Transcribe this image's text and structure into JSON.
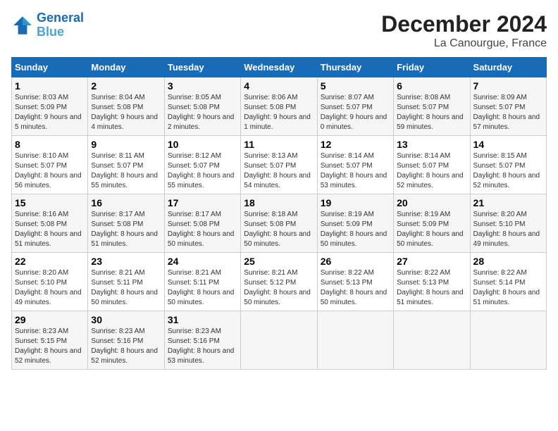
{
  "header": {
    "logo_line1": "General",
    "logo_line2": "Blue",
    "title": "December 2024",
    "subtitle": "La Canourgue, France"
  },
  "weekdays": [
    "Sunday",
    "Monday",
    "Tuesday",
    "Wednesday",
    "Thursday",
    "Friday",
    "Saturday"
  ],
  "weeks": [
    [
      {
        "day": 1,
        "sunrise": "8:03 AM",
        "sunset": "5:09 PM",
        "daylight": "9 hours and 5 minutes."
      },
      {
        "day": 2,
        "sunrise": "8:04 AM",
        "sunset": "5:08 PM",
        "daylight": "9 hours and 4 minutes."
      },
      {
        "day": 3,
        "sunrise": "8:05 AM",
        "sunset": "5:08 PM",
        "daylight": "9 hours and 2 minutes."
      },
      {
        "day": 4,
        "sunrise": "8:06 AM",
        "sunset": "5:08 PM",
        "daylight": "9 hours and 1 minute."
      },
      {
        "day": 5,
        "sunrise": "8:07 AM",
        "sunset": "5:07 PM",
        "daylight": "9 hours and 0 minutes."
      },
      {
        "day": 6,
        "sunrise": "8:08 AM",
        "sunset": "5:07 PM",
        "daylight": "8 hours and 59 minutes."
      },
      {
        "day": 7,
        "sunrise": "8:09 AM",
        "sunset": "5:07 PM",
        "daylight": "8 hours and 57 minutes."
      }
    ],
    [
      {
        "day": 8,
        "sunrise": "8:10 AM",
        "sunset": "5:07 PM",
        "daylight": "8 hours and 56 minutes."
      },
      {
        "day": 9,
        "sunrise": "8:11 AM",
        "sunset": "5:07 PM",
        "daylight": "8 hours and 55 minutes."
      },
      {
        "day": 10,
        "sunrise": "8:12 AM",
        "sunset": "5:07 PM",
        "daylight": "8 hours and 55 minutes."
      },
      {
        "day": 11,
        "sunrise": "8:13 AM",
        "sunset": "5:07 PM",
        "daylight": "8 hours and 54 minutes."
      },
      {
        "day": 12,
        "sunrise": "8:14 AM",
        "sunset": "5:07 PM",
        "daylight": "8 hours and 53 minutes."
      },
      {
        "day": 13,
        "sunrise": "8:14 AM",
        "sunset": "5:07 PM",
        "daylight": "8 hours and 52 minutes."
      },
      {
        "day": 14,
        "sunrise": "8:15 AM",
        "sunset": "5:07 PM",
        "daylight": "8 hours and 52 minutes."
      }
    ],
    [
      {
        "day": 15,
        "sunrise": "8:16 AM",
        "sunset": "5:08 PM",
        "daylight": "8 hours and 51 minutes."
      },
      {
        "day": 16,
        "sunrise": "8:17 AM",
        "sunset": "5:08 PM",
        "daylight": "8 hours and 51 minutes."
      },
      {
        "day": 17,
        "sunrise": "8:17 AM",
        "sunset": "5:08 PM",
        "daylight": "8 hours and 50 minutes."
      },
      {
        "day": 18,
        "sunrise": "8:18 AM",
        "sunset": "5:08 PM",
        "daylight": "8 hours and 50 minutes."
      },
      {
        "day": 19,
        "sunrise": "8:19 AM",
        "sunset": "5:09 PM",
        "daylight": "8 hours and 50 minutes."
      },
      {
        "day": 20,
        "sunrise": "8:19 AM",
        "sunset": "5:09 PM",
        "daylight": "8 hours and 50 minutes."
      },
      {
        "day": 21,
        "sunrise": "8:20 AM",
        "sunset": "5:10 PM",
        "daylight": "8 hours and 49 minutes."
      }
    ],
    [
      {
        "day": 22,
        "sunrise": "8:20 AM",
        "sunset": "5:10 PM",
        "daylight": "8 hours and 49 minutes."
      },
      {
        "day": 23,
        "sunrise": "8:21 AM",
        "sunset": "5:11 PM",
        "daylight": "8 hours and 50 minutes."
      },
      {
        "day": 24,
        "sunrise": "8:21 AM",
        "sunset": "5:11 PM",
        "daylight": "8 hours and 50 minutes."
      },
      {
        "day": 25,
        "sunrise": "8:21 AM",
        "sunset": "5:12 PM",
        "daylight": "8 hours and 50 minutes."
      },
      {
        "day": 26,
        "sunrise": "8:22 AM",
        "sunset": "5:13 PM",
        "daylight": "8 hours and 50 minutes."
      },
      {
        "day": 27,
        "sunrise": "8:22 AM",
        "sunset": "5:13 PM",
        "daylight": "8 hours and 51 minutes."
      },
      {
        "day": 28,
        "sunrise": "8:22 AM",
        "sunset": "5:14 PM",
        "daylight": "8 hours and 51 minutes."
      }
    ],
    [
      {
        "day": 29,
        "sunrise": "8:23 AM",
        "sunset": "5:15 PM",
        "daylight": "8 hours and 52 minutes."
      },
      {
        "day": 30,
        "sunrise": "8:23 AM",
        "sunset": "5:16 PM",
        "daylight": "8 hours and 52 minutes."
      },
      {
        "day": 31,
        "sunrise": "8:23 AM",
        "sunset": "5:16 PM",
        "daylight": "8 hours and 53 minutes."
      },
      null,
      null,
      null,
      null
    ]
  ]
}
